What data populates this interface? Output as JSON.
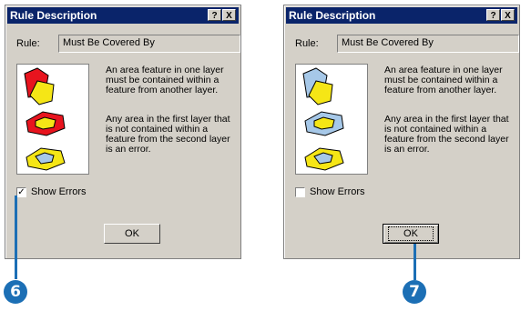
{
  "dialog_left": {
    "title": "Rule Description",
    "help_btn": "?",
    "close_btn": "X",
    "rule_label": "Rule:",
    "rule_value": "Must Be Covered By",
    "description_1": "An area feature in one layer must be contained within a feature from another layer.",
    "description_2": "Any area in the first layer that is not contained within a feature from the second layer is an error.",
    "show_errors_label": "Show Errors",
    "show_errors_checked": true,
    "ok_label": "OK"
  },
  "dialog_right": {
    "title": "Rule Description",
    "help_btn": "?",
    "close_btn": "X",
    "rule_label": "Rule:",
    "rule_value": "Must Be Covered By",
    "description_1": "An area feature in one layer must be contained within a feature from another layer.",
    "description_2": "Any area in the first layer that is not contained within a feature from the second layer is an error.",
    "show_errors_label": "Show Errors",
    "show_errors_checked": false,
    "ok_label": "OK"
  },
  "callouts": {
    "left": "6",
    "right": "7"
  },
  "colors": {
    "title_bar": "#0a246a",
    "callout": "#1c6fb5",
    "error_red": "#e8141e",
    "feature_yellow": "#f5e616",
    "feature_blue": "#a6c8e8"
  }
}
